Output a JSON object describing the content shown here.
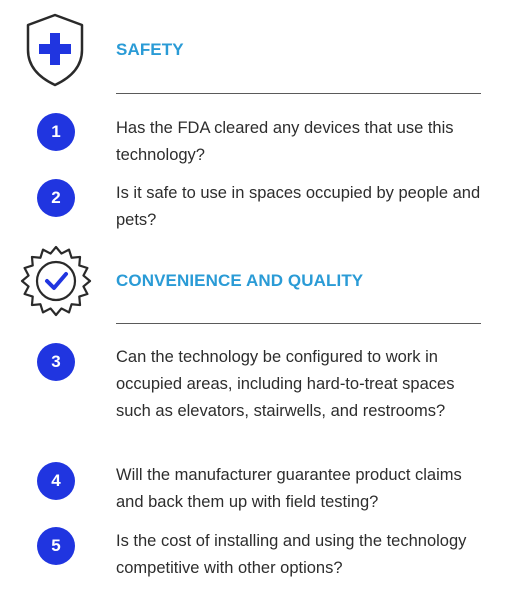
{
  "colors": {
    "accent_blue": "#2a9bd6",
    "badge_blue": "#2035e0",
    "icon_stroke": "#2a2a2a"
  },
  "sections": [
    {
      "title": "SAFETY",
      "icon": "shield-plus-icon"
    },
    {
      "title": "CONVENIENCE AND QUALITY",
      "icon": "badge-check-icon"
    }
  ],
  "questions": [
    {
      "number": "1",
      "text": "Has the FDA cleared any devices that use this technology?"
    },
    {
      "number": "2",
      "text": "Is it safe to use in spaces occupied by people and pets?"
    },
    {
      "number": "3",
      "text": "Can the technology be configured to work in occupied areas, including hard-to-treat spaces such as elevators, stairwells, and restrooms?"
    },
    {
      "number": "4",
      "text": "Will the manufacturer guarantee product claims and back them up with field testing?"
    },
    {
      "number": "5",
      "text": "Is the cost of installing and using the technology competitive with other options?"
    }
  ]
}
